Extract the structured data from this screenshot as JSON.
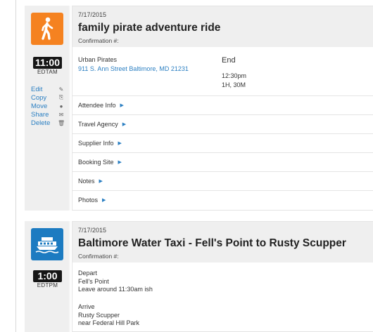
{
  "items": [
    {
      "date": "7/17/2015",
      "title": "family pirate adventure ride",
      "confirmation_label": "Confirmation #:",
      "time": "11:00",
      "timezone": "EDTAM",
      "icon": "pedestrian-walking-icon",
      "icon_color": "#f58220",
      "actions": [
        {
          "label": "Edit",
          "icon": "pencil-icon",
          "glyph": "✎"
        },
        {
          "label": "Copy",
          "icon": "copy-icon",
          "glyph": "⎘"
        },
        {
          "label": "Move",
          "icon": "move-icon",
          "glyph": "●"
        },
        {
          "label": "Share",
          "icon": "envelope-icon",
          "glyph": "✉"
        },
        {
          "label": "Delete",
          "icon": "trash-icon",
          "glyph": "🗑"
        }
      ],
      "vendor": "Urban Pirates",
      "address": "911 S. Ann Street Baltimore, MD 21231",
      "end_label": "End",
      "end_time": "12:30pm",
      "duration": "1H, 30M",
      "sections": [
        "Attendee Info",
        "Travel Agency",
        "Supplier Info",
        "Booking Site",
        "Notes",
        "Photos"
      ]
    },
    {
      "date": "7/17/2015",
      "title": "Baltimore Water Taxi - Fell's Point to Rusty Scupper",
      "confirmation_label": "Confirmation #:",
      "time": "1:00",
      "timezone": "EDTPM",
      "icon": "ferry-boat-icon",
      "icon_color": "#1c7bc1",
      "depart_label": "Depart",
      "depart_place": "Fell's Point",
      "depart_note": "Leave around 11:30am ish",
      "arrive_label": "Arrive",
      "arrive_place": "Rusty Scupper",
      "arrive_note": "near Federal Hill Park"
    }
  ]
}
